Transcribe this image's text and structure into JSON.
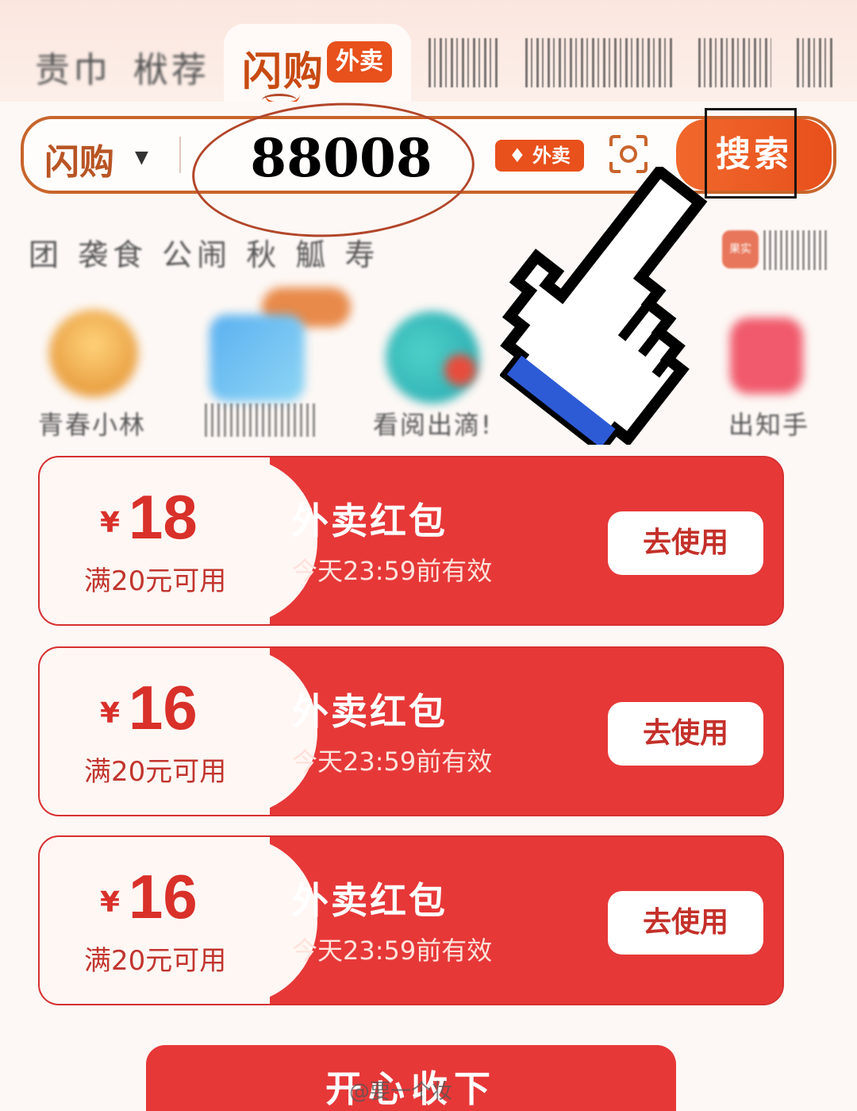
{
  "tabs": {
    "items": [
      {
        "label": "责巾"
      },
      {
        "label": "栿荐"
      }
    ],
    "active": {
      "label": "闪购",
      "badge": "外卖"
    }
  },
  "search": {
    "scope": "闪购",
    "value": "88008",
    "tag": "外卖",
    "button": "搜索"
  },
  "categories": {
    "row_text": "团 袭食 公闹 秋 觚 寿",
    "badge": "果实"
  },
  "grid": {
    "items": [
      {
        "label": "青春小林"
      },
      {
        "label": "看阅出滴!"
      },
      {
        "label": "出知手"
      }
    ]
  },
  "coupons": [
    {
      "currency": "¥",
      "amount": "18",
      "condition": "满20元可用",
      "title": "外卖红包",
      "expiry": "今天23:59前有效",
      "action": "去使用"
    },
    {
      "currency": "¥",
      "amount": "16",
      "condition": "满20元可用",
      "title": "外卖红包",
      "expiry": "今天23:59前有效",
      "action": "去使用"
    },
    {
      "currency": "¥",
      "amount": "16",
      "condition": "满20元可用",
      "title": "外卖红包",
      "expiry": "今天23:59前有效",
      "action": "去使用"
    }
  ],
  "collect_button": "开心收下",
  "watermark": "@要一个妆",
  "colors": {
    "accent": "#e8501c",
    "coupon_red": "#e73838",
    "annotation": "#b2462a"
  }
}
